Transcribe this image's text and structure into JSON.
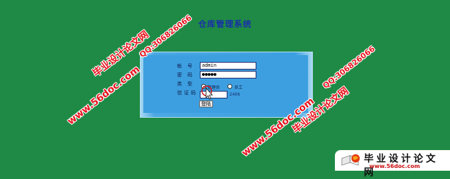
{
  "header": {
    "title": "仓库管理系统"
  },
  "login": {
    "account_label": "帐号",
    "account_value": "admin",
    "password_label": "密码",
    "password_value": "●●●●●",
    "type_label": "类型",
    "type_options": [
      "管理员",
      "员工"
    ],
    "type_selected": "管理员",
    "captcha_label": "验证码",
    "captcha_value": "",
    "captcha_text": "2406",
    "submit_label": "登陆"
  },
  "watermarks": {
    "url": "www.56doc.com",
    "site_name": "毕业设计论文网",
    "qq": "QQ:306826066"
  },
  "brand": {
    "title": "毕业设计论文网",
    "url": "www.56doc.com"
  }
}
